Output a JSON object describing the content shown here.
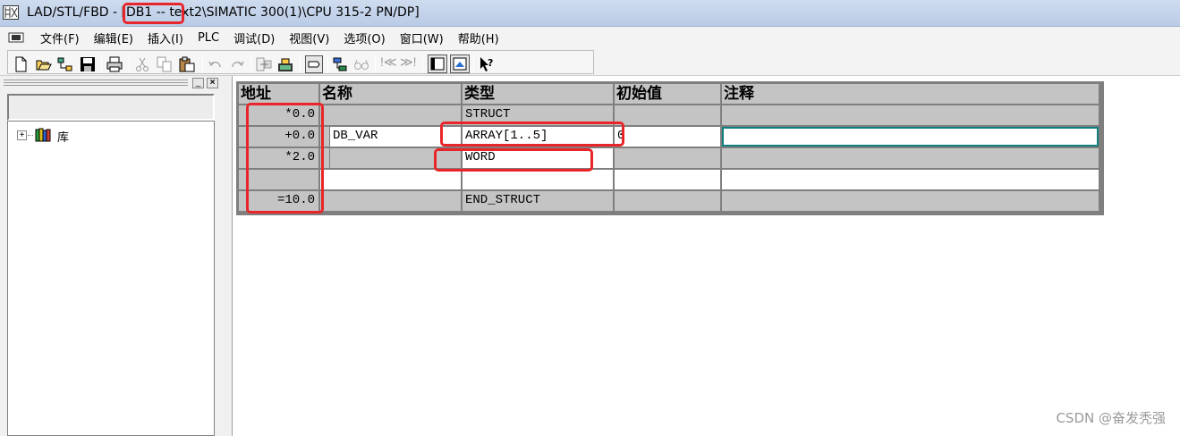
{
  "window": {
    "title_prefix": "LAD/STL/FBD",
    "title_sep": " - ",
    "title_db": "[DB1 -- ",
    "title_path": "text2\\SIMATIC 300(1)\\CPU 315-2 PN/DP]"
  },
  "menu": {
    "items": [
      "文件(F)",
      "编辑(E)",
      "插入(I)",
      "PLC",
      "调试(D)",
      "视图(V)",
      "选项(O)",
      "窗口(W)",
      "帮助(H)"
    ]
  },
  "toolbar": {
    "icons": [
      "new-icon",
      "open-icon",
      "accessible-nodes-icon",
      "save-icon",
      "print-icon",
      "cut-icon",
      "copy-icon",
      "paste-icon",
      "undo-icon",
      "redo-icon",
      "load-icon",
      "monitor-icon",
      "declaration-view-icon",
      "network-icon",
      "glasses-icon",
      "prev-icon",
      "next-icon",
      "data-view-icon",
      "overview-icon",
      "help-icon"
    ],
    "labels": {
      "prev": "!≪",
      "next": "≫!"
    }
  },
  "sidebar": {
    "tree": [
      {
        "label": "库",
        "expander": "+"
      }
    ]
  },
  "table": {
    "columns": [
      "地址",
      "名称",
      "类型",
      "初始值",
      "注释"
    ],
    "rows": [
      {
        "address": "*0.0",
        "name": "",
        "type": "STRUCT",
        "initial": "",
        "comment": ""
      },
      {
        "address": "+0.0",
        "name": "DB_VAR",
        "type": "ARRAY[1..5]",
        "initial": "0",
        "comment": ""
      },
      {
        "address": "*2.0",
        "name": "",
        "type": "WORD",
        "initial": "",
        "comment": ""
      },
      {
        "address": "",
        "name": "",
        "type": "",
        "initial": "",
        "comment": ""
      },
      {
        "address": "=10.0",
        "name": "",
        "type": "END_STRUCT",
        "initial": "",
        "comment": ""
      }
    ]
  },
  "watermark": "CSDN @奋发秃强",
  "colors": {
    "annotation": "#e8262a",
    "grid_gray": "#c4c4c4",
    "focus": "#0f7f7f"
  }
}
